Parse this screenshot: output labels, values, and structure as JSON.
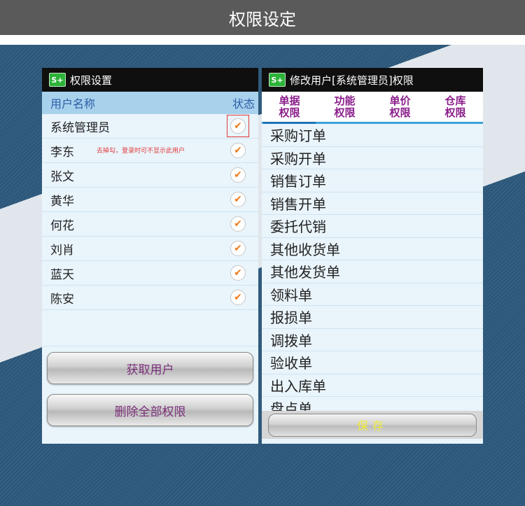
{
  "banner": {
    "title": "权限设定"
  },
  "left": {
    "title": "权限设置",
    "header": {
      "name": "用户名称",
      "status": "状态"
    },
    "note": "去掉勾，登录时可不显示此用户",
    "users": [
      "系统管理员",
      "李东",
      "张文",
      "黄华",
      "何花",
      "刘肖",
      "蓝天",
      "陈安"
    ],
    "buttons": {
      "get_users": "获取用户",
      "delete_all": "删除全部权限"
    }
  },
  "right": {
    "title": "修改用户[系统管理员]权限",
    "tabs": [
      {
        "line1": "单据",
        "line2": "权限"
      },
      {
        "line1": "功能",
        "line2": "权限"
      },
      {
        "line1": "单价",
        "line2": "权限"
      },
      {
        "line1": "仓库",
        "line2": "权限"
      }
    ],
    "items": [
      "采购订单",
      "采购开单",
      "销售订单",
      "销售开单",
      "委托代销",
      "其他收货单",
      "其他发货单",
      "领料单",
      "报损单",
      "调拨单",
      "验收单",
      "出入库单",
      "盘点单"
    ],
    "save": "保存"
  },
  "colors": {
    "accent": "#8a1d8a",
    "check": "#f07a1a",
    "note": "#e23a3a"
  },
  "icons": {
    "app": "app-logo-icon",
    "check": "check-icon"
  }
}
